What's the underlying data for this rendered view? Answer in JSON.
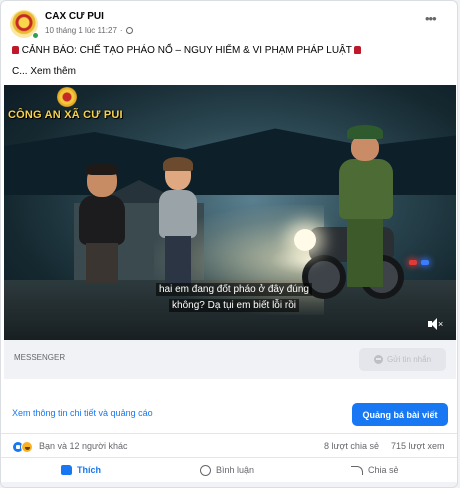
{
  "post": {
    "page_name": "CAX CƯ PUI",
    "date": "10 tháng 1 lúc 11:27",
    "separator": "·",
    "more_label": "•••",
    "headline_before": "CẢNH BÁO: CHẾ TẠO PHÁO NỔ – NGUY HIỂM & VI PHẠM PHÁP LUẬT",
    "text_prefix": "C...",
    "see_more": "Xem thêm"
  },
  "video": {
    "overlay_title": "CÔNG AN XÃ CƯ PUI",
    "subtitle_line1": "hai em đang đốt pháo ở đây đúng",
    "subtitle_line2": "không? Dạ tụi em biết lỗi rồi"
  },
  "cta": {
    "label": "MESSENGER",
    "send_button": "Gửi tin nhắn"
  },
  "details": {
    "link": "Xem thông tin chi tiết và quảng cáo",
    "boost_button": "Quảng bá bài viết"
  },
  "stats": {
    "reactions_text": "Bạn và 12 người khác",
    "shares": "8 lượt chia sẻ",
    "views": "715 lượt xem"
  },
  "actions": {
    "like": "Thích",
    "comment": "Bình luận",
    "share": "Chia sẻ"
  },
  "colors": {
    "accent": "#1877f2",
    "overlay_title": "#f7d24d",
    "secondary_text": "#65676b"
  }
}
